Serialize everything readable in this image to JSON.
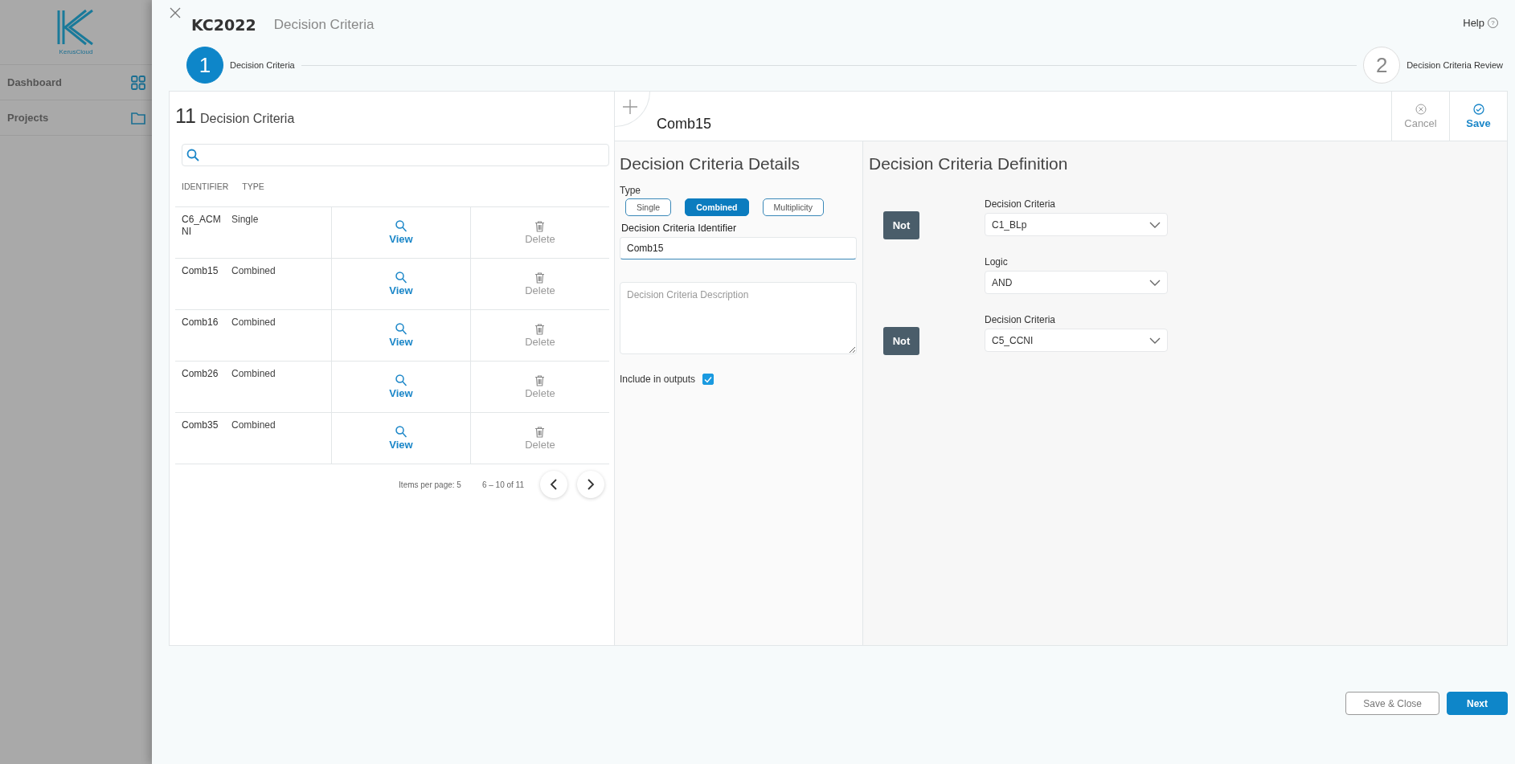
{
  "sidebar": {
    "logo_text": "KerusCloud",
    "items": [
      {
        "label": "Dashboard",
        "kind": "grid"
      },
      {
        "label": "Projects",
        "kind": "folder"
      }
    ]
  },
  "modal": {
    "title": "KC2022",
    "subtitle": "Decision Criteria",
    "help": "Help",
    "help_icon": "?"
  },
  "stepper": [
    {
      "number": "1",
      "label": "Decision Criteria",
      "selected": true
    },
    {
      "number": "2",
      "label": "Decision Criteria Review",
      "selected": false
    }
  ],
  "list_panel": {
    "count": "11",
    "title": "Decision Criteria",
    "columns": [
      "IDENTIFIER",
      "TYPE"
    ],
    "rows": [
      {
        "identifier": "C6_ACMNI",
        "type": "Single",
        "view": "View",
        "delete": "Delete"
      },
      {
        "identifier": "Comb15",
        "type": "Combined",
        "view": "View",
        "delete": "Delete"
      },
      {
        "identifier": "Comb16",
        "type": "Combined",
        "view": "View",
        "delete": "Delete"
      },
      {
        "identifier": "Comb26",
        "type": "Combined",
        "view": "View",
        "delete": "Delete"
      },
      {
        "identifier": "Comb35",
        "type": "Combined",
        "view": "View",
        "delete": "Delete"
      }
    ],
    "pagination": {
      "items_per_page": "Items per page: 5",
      "range": "6 – 10 of 11"
    }
  },
  "editor": {
    "name": "Comb15",
    "cancel": "Cancel",
    "save": "Save",
    "details": {
      "title": "Decision Criteria Details",
      "type_label": "Type",
      "types": [
        {
          "label": "Single",
          "selected": false
        },
        {
          "label": "Combined",
          "selected": true
        },
        {
          "label": "Multiplicity",
          "selected": false
        }
      ],
      "identifier_label": "Decision Criteria Identifier",
      "identifier_value": "Comb15",
      "description_placeholder": "Decision Criteria Description",
      "include_label": "Include in outputs",
      "include_checked": true
    },
    "definition": {
      "title": "Decision Criteria Definition",
      "rows": [
        {
          "kind": "criteria",
          "not": "Not",
          "label": "Decision Criteria",
          "value": "C1_BLp"
        },
        {
          "kind": "logic",
          "label": "Logic",
          "value": "AND"
        },
        {
          "kind": "criteria",
          "not": "Not",
          "label": "Decision Criteria",
          "value": "C5_CCNI"
        }
      ]
    }
  },
  "footer_buttons": [
    {
      "label": "Save & Close",
      "kind": "secondary"
    },
    {
      "label": "Next",
      "kind": "primary"
    }
  ]
}
